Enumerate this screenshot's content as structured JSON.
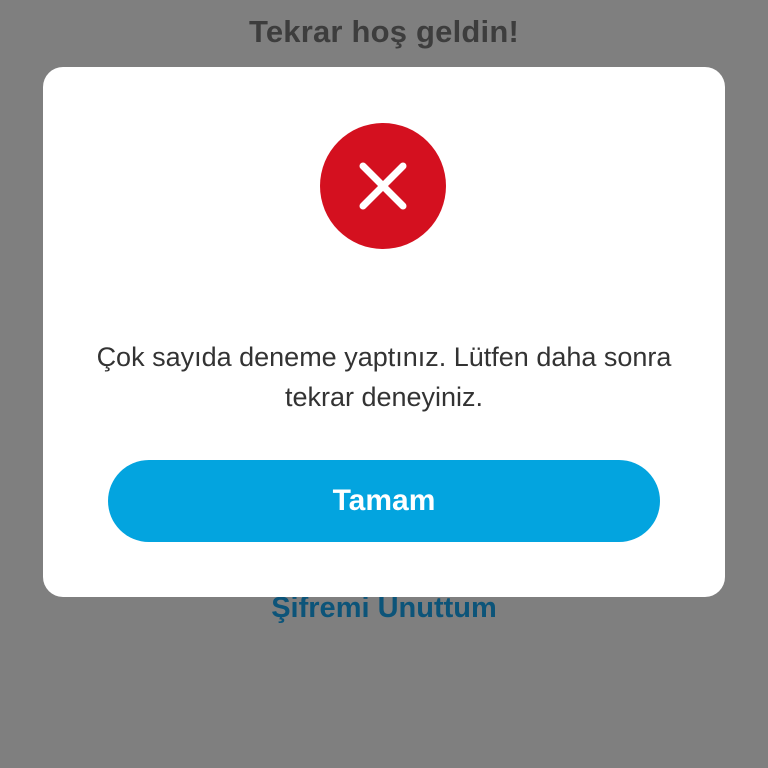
{
  "background": {
    "title": "Tekrar hoş geldin!",
    "forgot_password_link": "Şifremi Unuttum"
  },
  "dialog": {
    "icon": "error-x-icon",
    "icon_color": "#d4101f",
    "message": "Çok sayıda deneme yaptınız. Lütfen daha sonra tekrar deneyiniz.",
    "button_label": "Tamam",
    "button_color": "#03a4df"
  }
}
